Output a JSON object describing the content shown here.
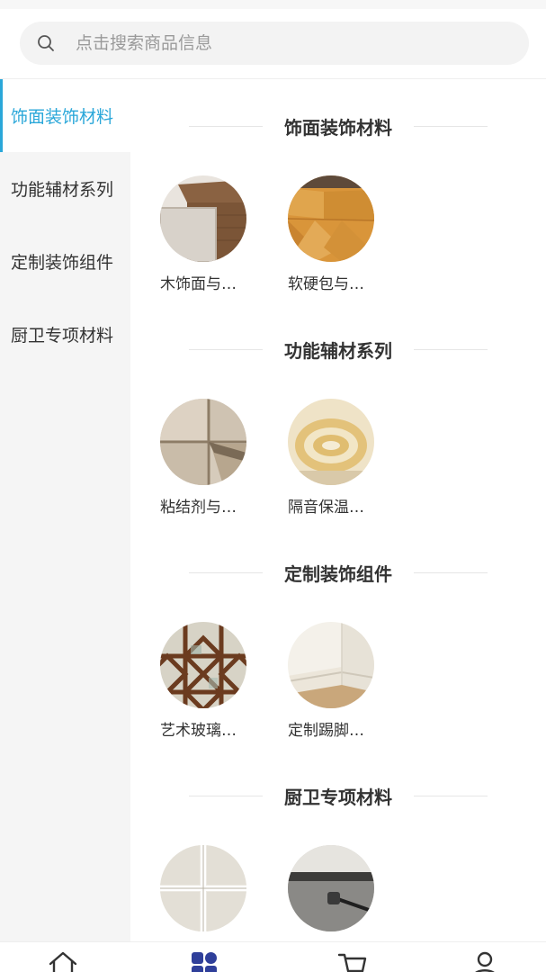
{
  "search": {
    "placeholder": "点击搜索商品信息"
  },
  "sidebar": {
    "items": [
      {
        "label": "饰面装饰材料",
        "active": true
      },
      {
        "label": "功能辅材系列",
        "active": false
      },
      {
        "label": "定制装饰组件",
        "active": false
      },
      {
        "label": "厨卫专项材料",
        "active": false
      }
    ]
  },
  "sections": [
    {
      "title": "饰面装饰材料",
      "items": [
        {
          "label": "木饰面与…",
          "icon": "wood-panel-photo"
        },
        {
          "label": "软硬包与…",
          "icon": "soft-panel-photo"
        }
      ]
    },
    {
      "title": "功能辅材系列",
      "items": [
        {
          "label": "粘结剂与…",
          "icon": "tile-adhesive-photo"
        },
        {
          "label": "隔音保温…",
          "icon": "insulation-roll-photo"
        }
      ]
    },
    {
      "title": "定制装饰组件",
      "items": [
        {
          "label": "艺术玻璃…",
          "icon": "art-glass-photo"
        },
        {
          "label": "定制踢脚…",
          "icon": "skirting-board-photo"
        }
      ]
    },
    {
      "title": "厨卫专项材料",
      "items": [
        {
          "label": "",
          "icon": "ceiling-panel-photo"
        },
        {
          "label": "",
          "icon": "waterproof-coating-photo"
        }
      ]
    }
  ],
  "tabbar": {
    "tabs": [
      {
        "icon": "home-icon",
        "active": false
      },
      {
        "icon": "category-icon",
        "active": true
      },
      {
        "icon": "cart-icon",
        "active": false
      },
      {
        "icon": "user-icon",
        "active": false
      }
    ]
  },
  "colors": {
    "accent": "#2aa7d9",
    "tab_active": "#2f3f9a",
    "text": "#333333",
    "sidebar_bg": "#f5f5f5"
  }
}
